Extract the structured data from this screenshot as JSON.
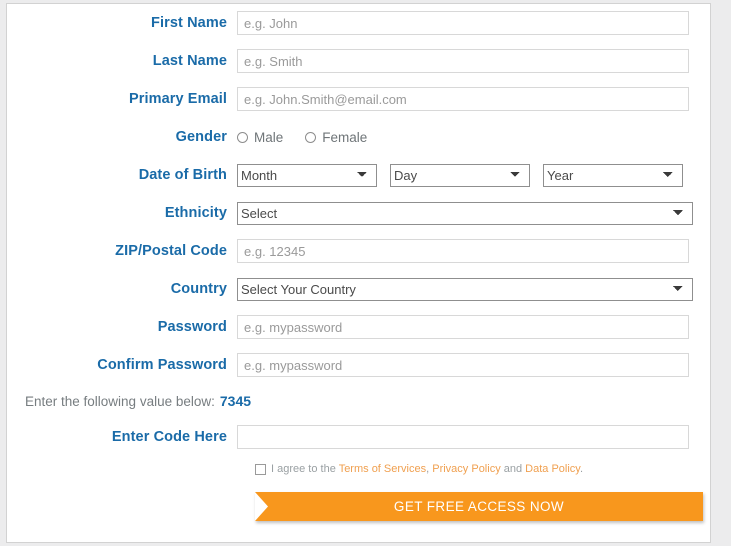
{
  "form": {
    "fields": [
      {
        "label": "First Name",
        "type": "text",
        "placeholder": "e.g. John",
        "value": "",
        "name": "first-name"
      },
      {
        "label": "Last Name",
        "type": "text",
        "placeholder": "e.g. Smith",
        "value": "",
        "name": "last-name"
      },
      {
        "label": "Primary Email",
        "type": "text",
        "placeholder": "e.g. John.Smith@email.com",
        "value": "",
        "name": "primary-email"
      },
      {
        "label": "Gender",
        "type": "radio",
        "name": "gender"
      },
      {
        "label": "Date of Birth",
        "type": "dob",
        "name": "date-of-birth"
      },
      {
        "label": "Ethnicity",
        "type": "select",
        "value": "Select",
        "name": "ethnicity"
      },
      {
        "label": "ZIP/Postal Code",
        "type": "text",
        "placeholder": "e.g. 12345",
        "value": "",
        "name": "zip-postal-code"
      },
      {
        "label": "Country",
        "type": "select",
        "value": "Select Your Country",
        "name": "country"
      },
      {
        "label": "Password",
        "type": "text",
        "placeholder": "e.g. mypassword",
        "value": "",
        "name": "password"
      },
      {
        "label": "Confirm Password",
        "type": "text",
        "placeholder": "e.g. mypassword",
        "value": "",
        "name": "confirm-password"
      }
    ],
    "gender": {
      "male_label": "Male",
      "female_label": "Female",
      "male_checked": false,
      "female_checked": false
    },
    "date_of_birth": {
      "month_value": "Month",
      "day_value": "Day",
      "year_value": "Year"
    },
    "captcha": {
      "prompt": "Enter the following value below:",
      "value": "7345",
      "code_label": "Enter Code Here",
      "code_value": "",
      "code_placeholder": ""
    },
    "terms": {
      "checked": false,
      "prefix": "I agree to the ",
      "link_terms": "Terms of Services",
      "separator_1": ", ",
      "link_privacy": "Privacy Policy",
      "separator_2": " and ",
      "link_data": "Data Policy",
      "suffix": "."
    },
    "submit": {
      "label": "GET FREE ACCESS NOW"
    }
  },
  "colors": {
    "label_blue": "#1a6ba8",
    "accent_orange": "#f8971d",
    "link_orange": "#f0a050",
    "page_background": "#ececed",
    "panel_background": "#ffffff"
  }
}
